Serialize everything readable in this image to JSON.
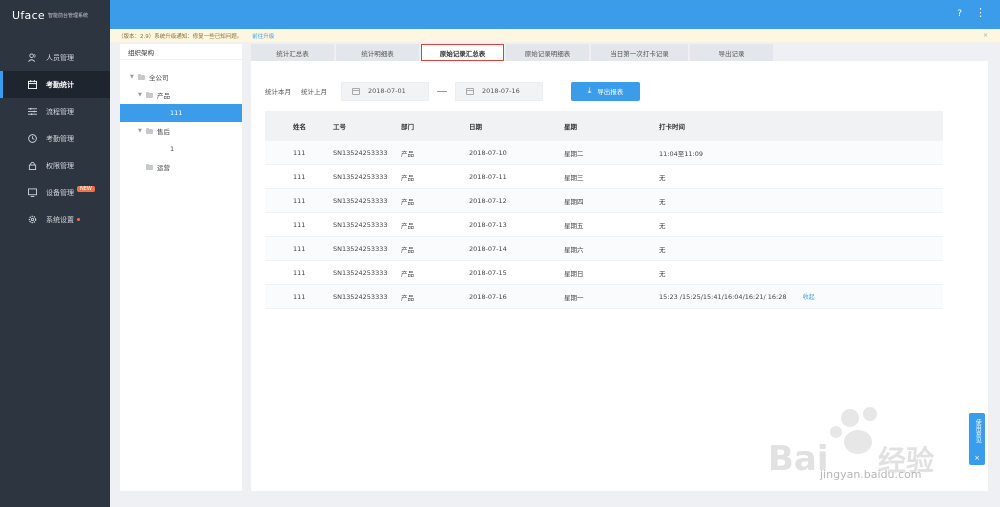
{
  "app": {
    "brand": "Uface",
    "brand_sub": "智能前台管理系统"
  },
  "header": {
    "help": "?",
    "more": "⋮"
  },
  "notice": {
    "text": "（版本：2.9）系统升级通知：修复一些已知问题。",
    "link": "前往升级",
    "close": "×"
  },
  "sidebar": {
    "items": [
      {
        "label": "人员管理",
        "icon": "users-icon"
      },
      {
        "label": "考勤统计",
        "icon": "calendar-icon",
        "active": true
      },
      {
        "label": "流程管理",
        "icon": "flow-icon"
      },
      {
        "label": "考勤管理",
        "icon": "clock-icon"
      },
      {
        "label": "权限管理",
        "icon": "lock-icon"
      },
      {
        "label": "设备管理",
        "icon": "device-icon",
        "badge": "NEW"
      },
      {
        "label": "系统设置",
        "icon": "gear-icon",
        "dot": true
      }
    ]
  },
  "org": {
    "title": "组织架构",
    "tree": [
      {
        "label": "全公司",
        "level": 0,
        "caret": "▼"
      },
      {
        "label": "产品",
        "level": 1,
        "caret": "▼"
      },
      {
        "label": "111",
        "level": 2,
        "selected": true
      },
      {
        "label": "售后",
        "level": 1,
        "caret": "▼"
      },
      {
        "label": "1",
        "level": 2
      },
      {
        "label": "运营",
        "level": 1
      }
    ]
  },
  "tabs": [
    {
      "label": "统计汇总表"
    },
    {
      "label": "统计明细表"
    },
    {
      "label": "原始记录汇总表",
      "active": true
    },
    {
      "label": "原始记录明细表"
    },
    {
      "label": "当日第一次打卡记录"
    },
    {
      "label": "导出记录"
    }
  ],
  "filters": {
    "this_month": "统计本月",
    "last_month": "统计上月",
    "start_date": "2018-07-01",
    "end_date": "2018-07-16",
    "export_label": "导出报表"
  },
  "table": {
    "headers": [
      "姓名",
      "工号",
      "部门",
      "日期",
      "星期",
      "打卡时间"
    ],
    "rows": [
      {
        "name": "111",
        "id": "SN13524253333",
        "dept": "产品",
        "date": "2018-07-10",
        "weekday": "星期二",
        "punch": "11:04至11:09"
      },
      {
        "name": "111",
        "id": "SN13524253333",
        "dept": "产品",
        "date": "2018-07-11",
        "weekday": "星期三",
        "punch": "无"
      },
      {
        "name": "111",
        "id": "SN13524253333",
        "dept": "产品",
        "date": "2018-07-12",
        "weekday": "星期四",
        "punch": "无"
      },
      {
        "name": "111",
        "id": "SN13524253333",
        "dept": "产品",
        "date": "2018-07-13",
        "weekday": "星期五",
        "punch": "无"
      },
      {
        "name": "111",
        "id": "SN13524253333",
        "dept": "产品",
        "date": "2018-07-14",
        "weekday": "星期六",
        "punch": "无"
      },
      {
        "name": "111",
        "id": "SN13524253333",
        "dept": "产品",
        "date": "2018-07-15",
        "weekday": "星期日",
        "punch": "无"
      },
      {
        "name": "111",
        "id": "SN13524253333",
        "dept": "产品",
        "date": "2018-07-16",
        "weekday": "星期一",
        "punch": "15:23 /15:25/15:41/16:04/16:21/ 16:28",
        "link": "收起"
      }
    ]
  },
  "feedback": {
    "label": "使用意见",
    "close": "×"
  },
  "watermark": {
    "text": "jingyan.baidu.com"
  }
}
